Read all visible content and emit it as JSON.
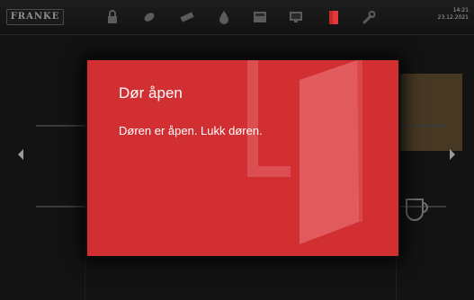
{
  "brand": {
    "logo": "FRANKE"
  },
  "header": {
    "time": "14:21",
    "date": "23.12.2021",
    "icons": [
      "lock-icon",
      "cleaning-icon",
      "milk-icon",
      "water-icon",
      "grounds-icon",
      "settings-screen-icon",
      "door-icon",
      "wrench-icon"
    ],
    "active_color": "#e4393c"
  },
  "dialog": {
    "title": "Dør åpen",
    "message": "Døren er åpen. Lukk døren.",
    "background_color": "#d22f33"
  }
}
